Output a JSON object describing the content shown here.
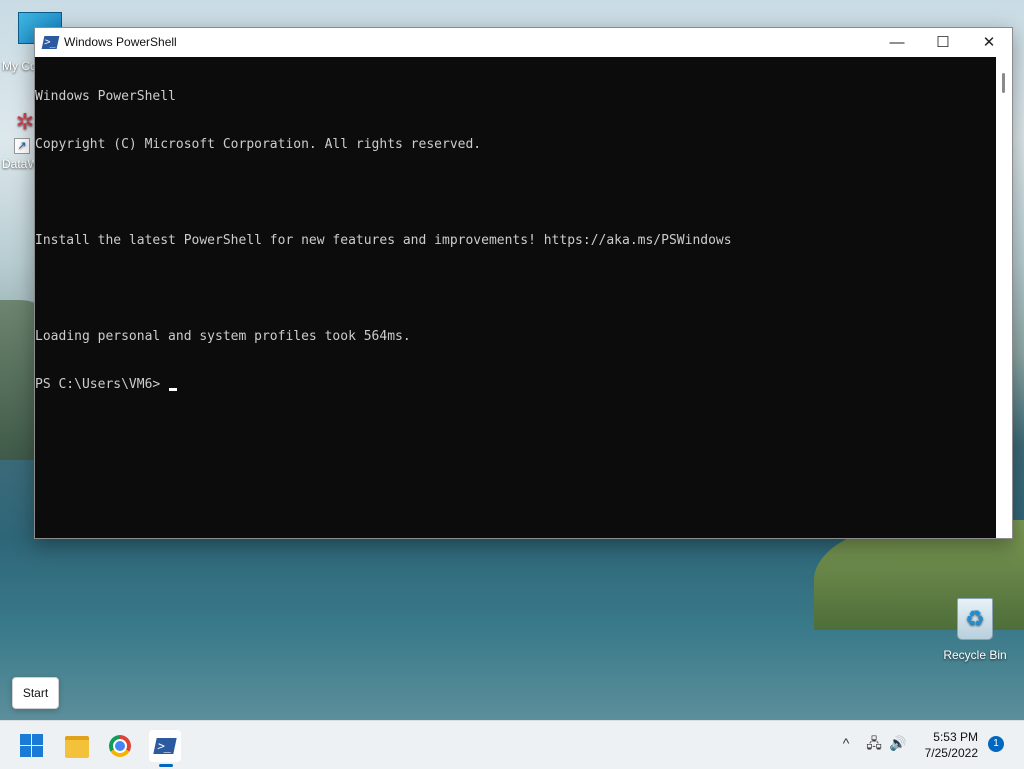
{
  "desktop": {
    "icons": [
      {
        "label": "My Co",
        "icon": "computer-icon"
      },
      {
        "label": "DataW",
        "icon": "datawrapper-icon"
      },
      {
        "label": "Recycle Bin",
        "icon": "recycle-bin-icon"
      }
    ],
    "start_tooltip": "Start"
  },
  "window": {
    "title": "Windows PowerShell",
    "controls": {
      "minimize": "—",
      "maximize": "☐",
      "close": "✕"
    },
    "console_lines": [
      "Windows PowerShell",
      "Copyright (C) Microsoft Corporation. All rights reserved.",
      "",
      "Install the latest PowerShell for new features and improvements! https://aka.ms/PSWindows",
      "",
      "Loading personal and system profiles took 564ms.",
      "PS C:\\Users\\VM6> "
    ]
  },
  "taskbar": {
    "apps": [
      {
        "name": "Start",
        "icon": "windows-logo-icon"
      },
      {
        "name": "File Explorer",
        "icon": "folder-icon"
      },
      {
        "name": "Google Chrome",
        "icon": "chrome-icon"
      },
      {
        "name": "Windows PowerShell",
        "icon": "powershell-icon",
        "active": true
      }
    ],
    "tray": {
      "chevron": "^",
      "network": "🖧",
      "volume": "🔊",
      "time": "5:53 PM",
      "date": "7/25/2022",
      "notifications": "1"
    }
  },
  "colors": {
    "console_bg": "#0c0c0c",
    "console_fg": "#cccccc",
    "accent": "#0067c0"
  }
}
